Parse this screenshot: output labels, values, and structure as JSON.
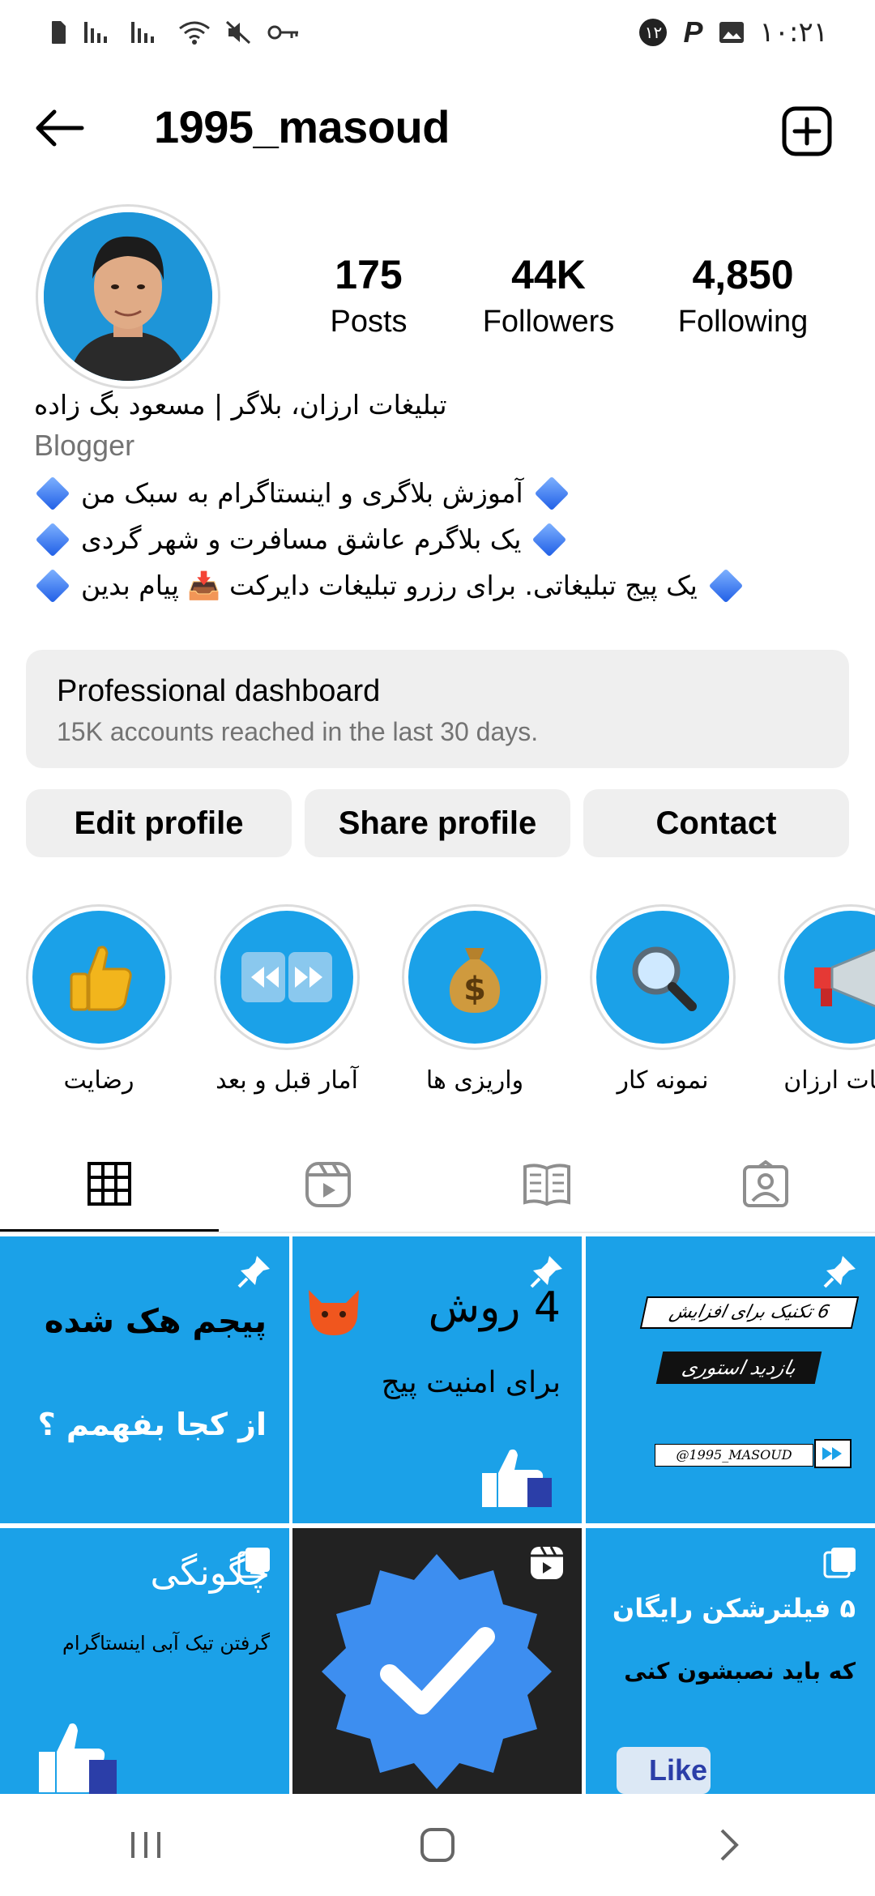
{
  "status_bar": {
    "time": "۱۰:۲۱",
    "notification_count": "۱۲",
    "left_icons": [
      "sim-card-icon",
      "signal-icon",
      "signal-icon",
      "wifi-icon",
      "mute-icon",
      "vpn-key-icon"
    ],
    "right_icons": [
      "notification-count",
      "p-app-icon",
      "gallery-icon"
    ]
  },
  "header": {
    "username": "1995_masoud"
  },
  "profile": {
    "stats": [
      {
        "value": "175",
        "label": "Posts"
      },
      {
        "value": "44K",
        "label": "Followers"
      },
      {
        "value": "4,850",
        "label": "Following"
      }
    ],
    "name": "تبلیغات ارزان، بلاگر | مسعود بگ زاده",
    "category": "Blogger",
    "bio_lines": [
      "آموزش بلاگری و اینستاگرام به سبک من",
      "یک بلاگرم عاشق مسافرت و شهر گردی",
      "یک پیج تبلیغاتی. برای رزرو تبلیغات دایرکت 📥 پیام بدین"
    ]
  },
  "dashboard": {
    "title": "Professional dashboard",
    "subtitle": "15K accounts reached in the last 30 days."
  },
  "actions": {
    "edit": "Edit profile",
    "share": "Share profile",
    "contact": "Contact"
  },
  "highlights": [
    {
      "label": "رضایت",
      "icon": "thumbs-up-icon"
    },
    {
      "label": "آمار قبل و بعد",
      "icon": "rewind-forward-icon"
    },
    {
      "label": "واریزی ها",
      "icon": "money-bag-icon"
    },
    {
      "label": "نمونه کار",
      "icon": "magnifier-icon"
    },
    {
      "label": "تبلیغات ارزان",
      "icon": "megaphone-icon"
    }
  ],
  "tabs": [
    {
      "name": "posts",
      "icon": "grid-icon"
    },
    {
      "name": "reels",
      "icon": "reels-icon"
    },
    {
      "name": "guides",
      "icon": "guide-book-icon"
    },
    {
      "name": "tagged",
      "icon": "tagged-person-icon"
    }
  ],
  "posts": [
    {
      "lines": [
        "پیجم هک شده",
        "از کجا بفهمم ؟"
      ],
      "badge": "pin"
    },
    {
      "lines": [
        "4 روش",
        "برای امنیت پیج"
      ],
      "badge": "pin"
    },
    {
      "lines": [
        "6 تکنیک برای افزایش",
        "بازدید استوری",
        "@1995_MASOUD"
      ],
      "badge": "pin"
    },
    {
      "lines": [
        "چگونگی",
        "گرفتن تیک آبی اینستاگرام"
      ],
      "badge": "multi"
    },
    {
      "lines": [],
      "badge": "reel"
    },
    {
      "lines": [
        "۵ فیلترشکن رایگان",
        "که باید نصبشون کنی",
        "Like"
      ],
      "badge": "multi"
    }
  ],
  "colors": {
    "accent_blue": "#1ba1e8",
    "dashboard_bg": "#efefef",
    "muted_text": "#737373"
  }
}
